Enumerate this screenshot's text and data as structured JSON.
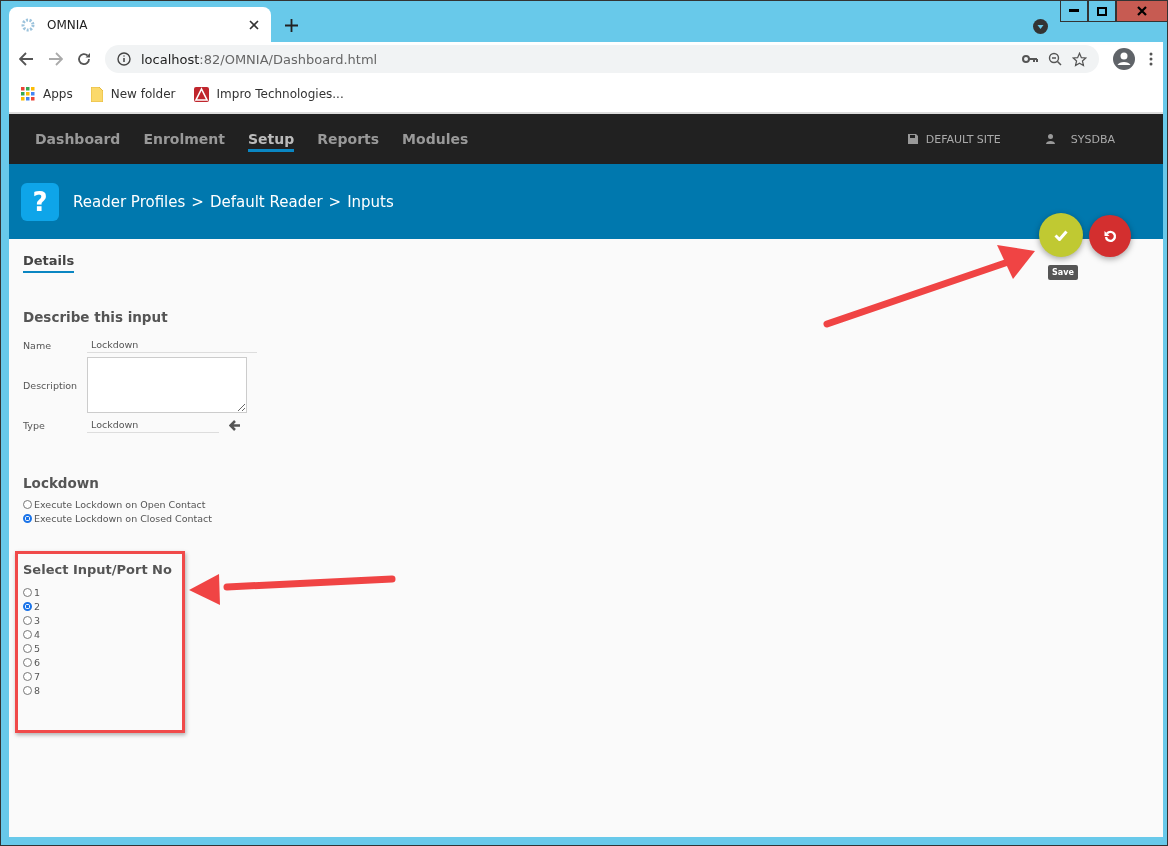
{
  "browser": {
    "tab_title": "OMNIA",
    "url_host": "localhost",
    "url_rest": ":82/OMNIA/Dashboard.html",
    "bookmarks": [
      {
        "kind": "apps",
        "label": "Apps"
      },
      {
        "kind": "folder",
        "label": "New folder"
      },
      {
        "kind": "site",
        "label": "Impro Technologies..."
      }
    ]
  },
  "nav": {
    "items": [
      {
        "label": "Dashboard",
        "selected": false
      },
      {
        "label": "Enrolment",
        "selected": false
      },
      {
        "label": "Setup",
        "selected": true
      },
      {
        "label": "Reports",
        "selected": false
      },
      {
        "label": "Modules",
        "selected": false
      }
    ],
    "site": "DEFAULT SITE",
    "user": "SYSDBA"
  },
  "header": {
    "icon": "?",
    "breadcrumb": [
      {
        "label": "Reader Profiles",
        "sep": ">"
      },
      {
        "label": "Default Reader",
        "sep": ">"
      },
      {
        "label": "Inputs"
      }
    ]
  },
  "actions": {
    "save_tooltip": "Save"
  },
  "tabs": [
    {
      "label": "Details",
      "selected": true
    }
  ],
  "describe": {
    "title": "Describe this input",
    "name_label": "Name",
    "name_value": "Lockdown",
    "description_label": "Description",
    "type_label": "Type",
    "type_value": "Lockdown"
  },
  "lockdown": {
    "title": "Lockdown",
    "options": [
      {
        "label": "Execute Lockdown on Open Contact",
        "selected": false
      },
      {
        "label": "Execute Lockdown on Closed Contact",
        "selected": true
      }
    ]
  },
  "ports": {
    "title": "Select Input/Port No",
    "options": [
      {
        "label": "1",
        "selected": false
      },
      {
        "label": "2",
        "selected": true
      },
      {
        "label": "3",
        "selected": false
      },
      {
        "label": "4",
        "selected": false
      },
      {
        "label": "5",
        "selected": false
      },
      {
        "label": "6",
        "selected": false
      },
      {
        "label": "7",
        "selected": false
      },
      {
        "label": "8",
        "selected": false
      }
    ]
  }
}
